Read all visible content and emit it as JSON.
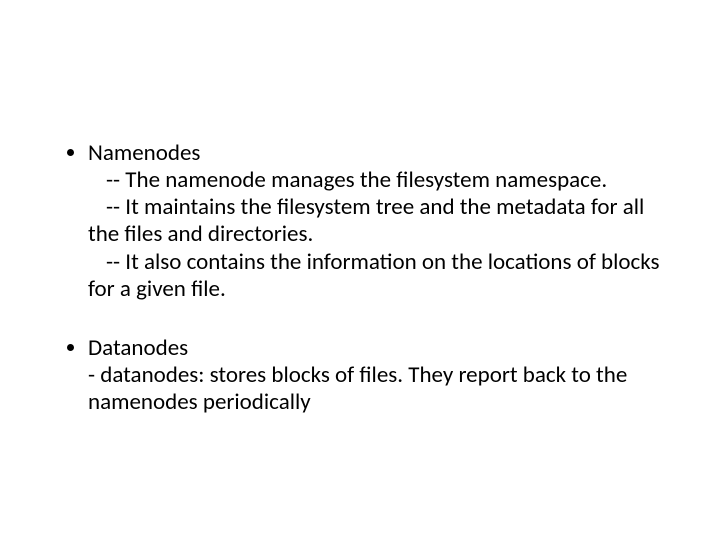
{
  "bullets": [
    {
      "title": "Namenodes",
      "lines": [
        "-- The namenode manages the filesystem namespace.",
        "-- It maintains the filesystem tree and the metadata for all the files and directories.",
        "-- It also contains the information on the locations of blocks for a given file."
      ]
    },
    {
      "title": " Datanodes",
      "lines": [
        "- datanodes: stores blocks of files.  They report back to the namenodes periodically"
      ]
    }
  ]
}
